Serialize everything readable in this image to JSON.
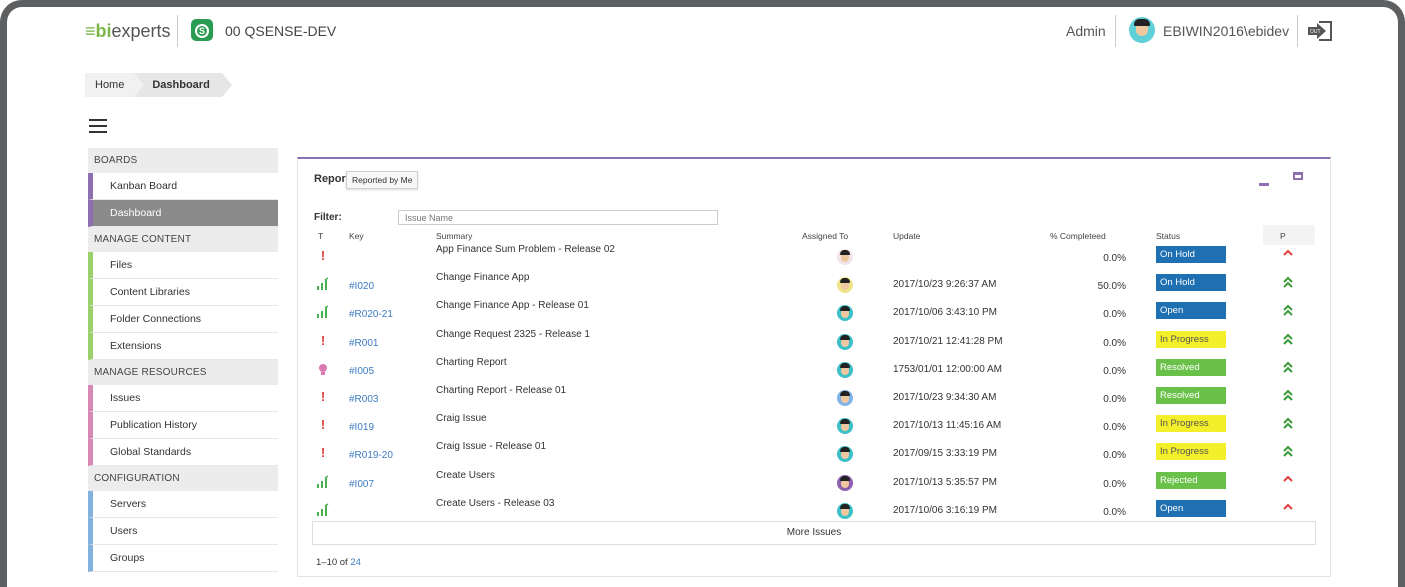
{
  "header": {
    "logo": {
      "prefix": "bi",
      "suffix": "experts"
    },
    "app_name": "00 QSENSE-DEV",
    "role": "Admin",
    "username": "EBIWIN2016\\ebidev",
    "logout_label": "OUT"
  },
  "breadcrumb": [
    "Home",
    "Dashboard"
  ],
  "sidebar": {
    "sections": [
      {
        "title": "BOARDS",
        "color": "#8e6fb0",
        "items": [
          {
            "label": "Kanban Board",
            "active": false
          },
          {
            "label": "Dashboard",
            "active": true
          }
        ]
      },
      {
        "title": "MANAGE CONTENT",
        "color": "#9bd16a",
        "items": [
          {
            "label": "Files"
          },
          {
            "label": "Content Libraries"
          },
          {
            "label": "Folder Connections"
          },
          {
            "label": "Extensions"
          }
        ]
      },
      {
        "title": "MANAGE RESOURCES",
        "color": "#d789b3",
        "items": [
          {
            "label": "Issues"
          },
          {
            "label": "Publication History"
          },
          {
            "label": "Global Standards"
          }
        ]
      },
      {
        "title": "CONFIGURATION",
        "color": "#82b1dd",
        "items": [
          {
            "label": "Servers"
          },
          {
            "label": "Users"
          },
          {
            "label": "Groups"
          }
        ]
      }
    ]
  },
  "panel": {
    "title": "Repor",
    "tooltip": "Reported by Me",
    "filter_label": "Filter:",
    "filter_placeholder": "Issue Name",
    "columns": {
      "type": "T",
      "key": "Key",
      "summary": "Summary",
      "assigned": "Assigned To",
      "update": "Update",
      "pct": "% Completeed",
      "status": "Status",
      "priority": "P"
    },
    "rows": [
      {
        "type": "exclaim",
        "key": "",
        "summary": "App Finance Sum Problem - Release 02",
        "avatar": "female",
        "update": "",
        "pct": "0.0%",
        "status": "On Hold",
        "status_color": "#1f6fb3",
        "priority": "up-single",
        "prio_color": "#e0403a"
      },
      {
        "type": "chart",
        "key": "#I020",
        "summary": "Change Finance App",
        "avatar": "yellow",
        "update": "2017/10/23 9:26:37 AM",
        "pct": "50.0%",
        "status": "On Hold",
        "status_color": "#1f6fb3",
        "priority": "up-double",
        "prio_color": "#3a9a3a"
      },
      {
        "type": "chart",
        "key": "#R020-21",
        "summary": "Change Finance App - Release 01",
        "avatar": "teal",
        "update": "2017/10/06 3:43:10 PM",
        "pct": "0.0%",
        "status": "Open",
        "status_color": "#1f6fb3",
        "priority": "up-double",
        "prio_color": "#3a9a3a"
      },
      {
        "type": "exclaim",
        "key": "#R001",
        "summary": "Change Request 2325 - Release 1",
        "avatar": "teal",
        "update": "2017/10/21 12:41:28 PM",
        "pct": "0.0%",
        "status": "In Progress",
        "status_color": "#f3ef2b",
        "priority": "up-double",
        "prio_color": "#3a9a3a"
      },
      {
        "type": "bulb",
        "key": "#I005",
        "summary": "Charting Report",
        "avatar": "teal",
        "update": "1753/01/01 12:00:00 AM",
        "pct": "0.0%",
        "status": "Resolved",
        "status_color": "#6ac14a",
        "priority": "up-double",
        "prio_color": "#3a9a3a"
      },
      {
        "type": "exclaim",
        "key": "#R003",
        "summary": "Charting Report - Release 01",
        "avatar": "blue",
        "update": "2017/10/23 9:34:30 AM",
        "pct": "0.0%",
        "status": "Resolved",
        "status_color": "#6ac14a",
        "priority": "up-double",
        "prio_color": "#3a9a3a"
      },
      {
        "type": "exclaim",
        "key": "#I019",
        "summary": "Craig Issue",
        "avatar": "teal",
        "update": "2017/10/13 11:45:16 AM",
        "pct": "0.0%",
        "status": "In Progress",
        "status_color": "#f3ef2b",
        "priority": "up-double",
        "prio_color": "#3a9a3a"
      },
      {
        "type": "exclaim",
        "key": "#R019-20",
        "summary": "Craig Issue - Release 01",
        "avatar": "teal",
        "update": "2017/09/15 3:33:19 PM",
        "pct": "0.0%",
        "status": "In Progress",
        "status_color": "#f3ef2b",
        "priority": "up-double",
        "prio_color": "#3a9a3a"
      },
      {
        "type": "chart",
        "key": "#I007",
        "summary": "Create Users",
        "avatar": "purple",
        "update": "2017/10/13 5:35:57 PM",
        "pct": "0.0%",
        "status": "Rejected",
        "status_color": "#6ac14a",
        "priority": "up-single",
        "prio_color": "#e0403a"
      },
      {
        "type": "chart",
        "key": "",
        "summary": "Create Users - Release 03",
        "avatar": "teal",
        "update": "2017/10/06 3:16:19 PM",
        "pct": "0.0%",
        "status": "Open",
        "status_color": "#1f6fb3",
        "priority": "up-single",
        "prio_color": "#e0403a"
      }
    ],
    "more_label": "More Issues",
    "pager_range": "1–10 of",
    "pager_total": "24"
  },
  "colors": {
    "accent": "#8e6fb0",
    "link": "#3c7bbf",
    "brand_green": "#7ab648"
  }
}
